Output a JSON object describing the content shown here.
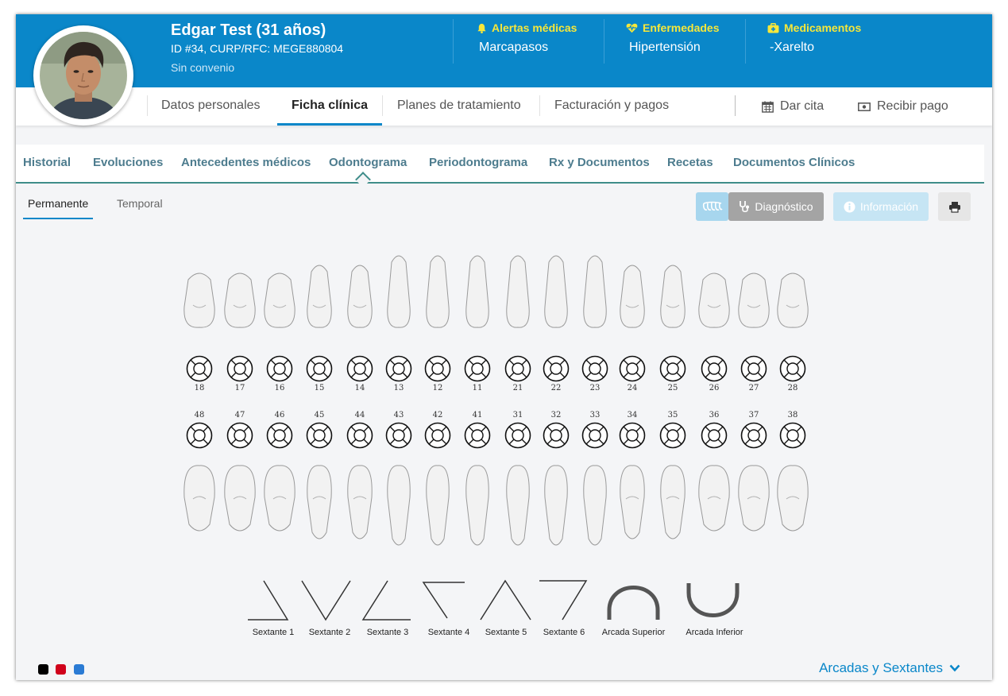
{
  "patient": {
    "name": "Edgar Test (31 años)",
    "id_line": "ID #34, CURP/RFC: MEGE880804",
    "convenio": "Sin convenio"
  },
  "header_info": [
    {
      "title": "Alertas médicas",
      "value": "Marcapasos",
      "icon": "bell-icon"
    },
    {
      "title": "Enfermedades",
      "value": "Hipertensión",
      "icon": "heartbeat-icon"
    },
    {
      "title": "Medicamentos",
      "value": "-Xarelto",
      "icon": "medkit-icon"
    }
  ],
  "main_tabs": [
    "Datos personales",
    "Ficha clínica",
    "Planes de tratamiento",
    "Facturación y pagos"
  ],
  "main_active": "Ficha clínica",
  "actions": {
    "dar_cita": "Dar cita",
    "recibir_pago": "Recibir pago"
  },
  "sub_tabs": [
    "Historial",
    "Evoluciones",
    "Antecedentes médicos",
    "Odontograma",
    "Periodontograma",
    "Rx y Documentos",
    "Recetas",
    "Documentos Clínicos"
  ],
  "sub_active": "Odontograma",
  "dentition_tabs": {
    "permanente": "Permanente",
    "temporal": "Temporal"
  },
  "buttons": {
    "diagnostico": "Diagnóstico",
    "informacion": "Información"
  },
  "upper_teeth": [
    "18",
    "17",
    "16",
    "15",
    "14",
    "13",
    "12",
    "11",
    "21",
    "22",
    "23",
    "24",
    "25",
    "26",
    "27",
    "28"
  ],
  "lower_teeth": [
    "48",
    "47",
    "46",
    "45",
    "44",
    "43",
    "42",
    "41",
    "31",
    "32",
    "33",
    "34",
    "35",
    "36",
    "37",
    "38"
  ],
  "sextants": [
    "Sextante 1",
    "Sextante 2",
    "Sextante 3",
    "Sextante 4",
    "Sextante 5",
    "Sextante 6",
    "Arcada Superior",
    "Arcada Inferior"
  ],
  "colors": {
    "header": "#0a87c9",
    "alert_title": "#f6e73a",
    "legend": [
      "#000000",
      "#d0021b",
      "#2a7bd4"
    ]
  },
  "arcadas_toggle": "Arcadas y Sextantes"
}
